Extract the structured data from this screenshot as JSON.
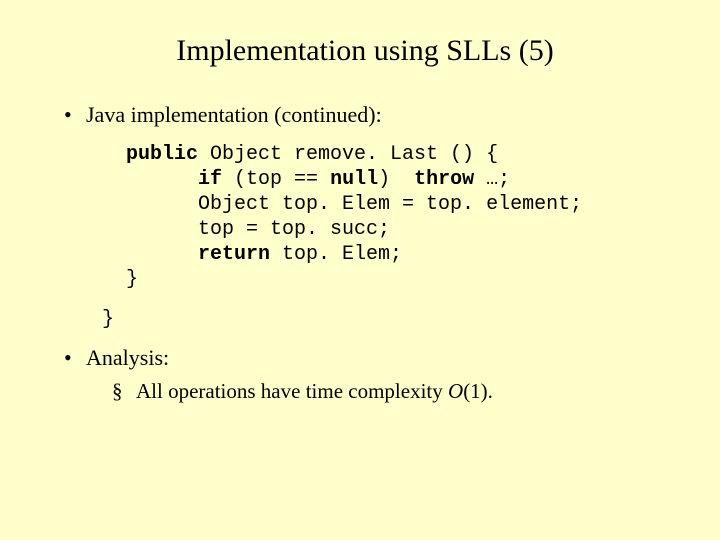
{
  "title": "Implementation using SLLs (5)",
  "bullet1": "Java implementation (continued):",
  "code": {
    "l1a": "public",
    "l1b": " Object remove. Last () {",
    "l2a": "if",
    "l2b": " (top == ",
    "l2c": "null",
    "l2d": ")  ",
    "l2e": "throw",
    "l2f": " …;",
    "l3": "Object top. Elem = top. element;",
    "l4": "top = top. succ;",
    "l5a": "return",
    "l5b": " top. Elem;",
    "l6": "}",
    "outerBrace": "}"
  },
  "bullet2": "Analysis:",
  "subbullet_pre": "All operations have time complexity ",
  "subbullet_O": "O",
  "subbullet_post": "(1)."
}
